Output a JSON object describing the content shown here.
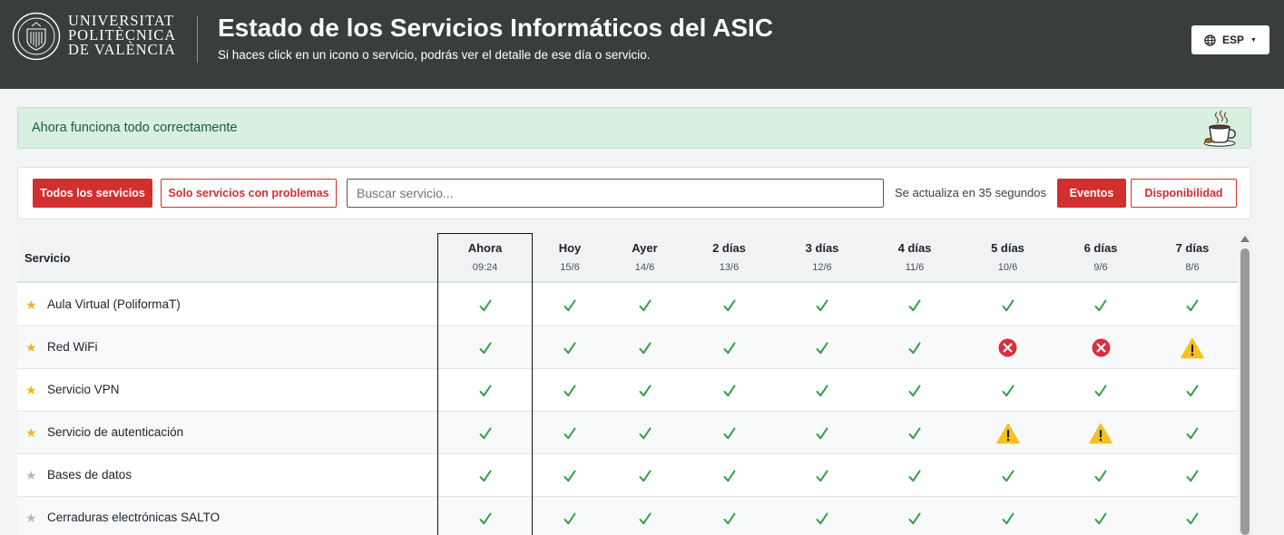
{
  "header": {
    "university_line1": "UNIVERSITAT",
    "university_line2": "POLITÈCNICA",
    "university_line3": "DE VALÈNCIA",
    "title": "Estado de los Servicios Informáticos del ASIC",
    "subtitle": "Si haces click en un icono o servicio, podrás ver el detalle de ese día o servicio.",
    "language": "ESP"
  },
  "status_message": "Ahora funciona todo correctamente",
  "filters": {
    "all_label": "Todos los servicios",
    "problems_label": "Solo servicios con problemas",
    "search_placeholder": "Buscar servicio...",
    "update_text": "Se actualiza en 35 segundos",
    "events_label": "Eventos",
    "availability_label": "Disponibilidad"
  },
  "table": {
    "service_header": "Servicio",
    "columns": [
      {
        "label": "Ahora",
        "date": "09:24"
      },
      {
        "label": "Hoy",
        "date": "15/6"
      },
      {
        "label": "Ayer",
        "date": "14/6"
      },
      {
        "label": "2 días",
        "date": "13/6"
      },
      {
        "label": "3 días",
        "date": "12/6"
      },
      {
        "label": "4 días",
        "date": "11/6"
      },
      {
        "label": "5 días",
        "date": "10/6"
      },
      {
        "label": "6 días",
        "date": "9/6"
      },
      {
        "label": "7 días",
        "date": "8/6"
      }
    ],
    "rows": [
      {
        "name": "Aula Virtual (PoliformaT)",
        "favorite": true,
        "status": [
          "ok",
          "ok",
          "ok",
          "ok",
          "ok",
          "ok",
          "ok",
          "ok",
          "ok"
        ]
      },
      {
        "name": "Red WiFi",
        "favorite": true,
        "status": [
          "ok",
          "ok",
          "ok",
          "ok",
          "ok",
          "ok",
          "error",
          "error",
          "warning"
        ]
      },
      {
        "name": "Servicio VPN",
        "favorite": true,
        "status": [
          "ok",
          "ok",
          "ok",
          "ok",
          "ok",
          "ok",
          "ok",
          "ok",
          "ok"
        ]
      },
      {
        "name": "Servicio de autenticación",
        "favorite": true,
        "status": [
          "ok",
          "ok",
          "ok",
          "ok",
          "ok",
          "ok",
          "warning",
          "warning",
          "ok"
        ]
      },
      {
        "name": "Bases de datos",
        "favorite": false,
        "status": [
          "ok",
          "ok",
          "ok",
          "ok",
          "ok",
          "ok",
          "ok",
          "ok",
          "ok"
        ]
      },
      {
        "name": "Cerraduras electrónicas SALTO",
        "favorite": false,
        "status": [
          "ok",
          "ok",
          "ok",
          "ok",
          "ok",
          "ok",
          "ok",
          "ok",
          "ok"
        ]
      }
    ]
  },
  "colors": {
    "header_bg": "#3a3d3d",
    "accent_red": "#d32f2f",
    "ok_green": "#2e9e47",
    "error_red": "#d9303e",
    "warning_yellow": "#f6c21b",
    "alert_bg": "#d9efe0"
  },
  "icons": {
    "ok": "check-icon",
    "error": "error-circle-icon",
    "warning": "warning-triangle-icon",
    "favorite": "star-icon",
    "language": "globe-icon",
    "status": "coffee-cup-icon"
  }
}
